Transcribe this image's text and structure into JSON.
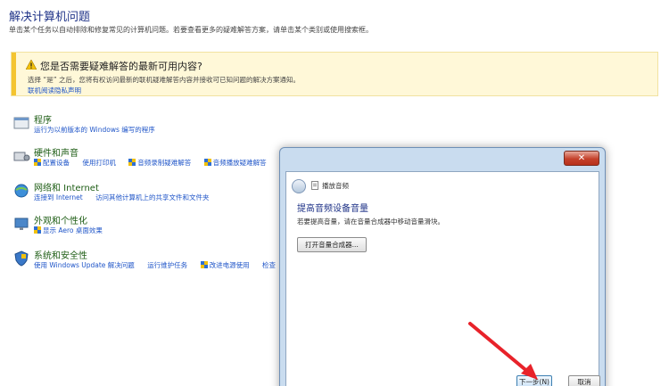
{
  "header": {
    "title": "解决计算机问题",
    "subtitle": "单击某个任务以自动排除和修复常见的计算机问题。若要查看更多的疑难解答方案，请单击某个类别或使用搜索框。"
  },
  "notice": {
    "title": "您是否需要疑难解答的最新可用内容?",
    "body": "选择 “是” 之后，您将有权访问最新的联机疑难解答内容并接收可已知问题的解决方案通知。",
    "link": "联机阅读隐私声明",
    "accent_color": "#f4c430"
  },
  "categories": [
    {
      "title": "程序",
      "icon": "programs-icon",
      "links": [
        "运行为以前版本的 Windows 编写的程序"
      ]
    },
    {
      "title": "硬件和声音",
      "icon": "hardware-sound-icon",
      "links": [
        "配置设备",
        "使用打印机",
        "音频录制疑难解答",
        "音频播放疑难解答"
      ]
    },
    {
      "title": "网络和 Internet",
      "icon": "network-icon",
      "links": [
        "连接到 Internet",
        "访问其他计算机上的共享文件和文件夹"
      ]
    },
    {
      "title": "外观和个性化",
      "icon": "appearance-icon",
      "links": [
        "显示 Aero 桌面效果"
      ]
    },
    {
      "title": "系统和安全性",
      "icon": "security-icon",
      "links": [
        "使用 Windows Update 解决问题",
        "运行维护任务",
        "改进电源使用",
        "检查"
      ]
    }
  ],
  "dialog": {
    "name": "播放音频",
    "heading": "提高音频设备音量",
    "description": "若要提高音量，请在音量合成器中移动音量滑块。",
    "open_mixer_label": "打开音量合成器...",
    "next_label": "下一步(N)",
    "cancel_label": "取消",
    "close_label": "✕"
  },
  "colors": {
    "arrow": "#e8222a"
  }
}
